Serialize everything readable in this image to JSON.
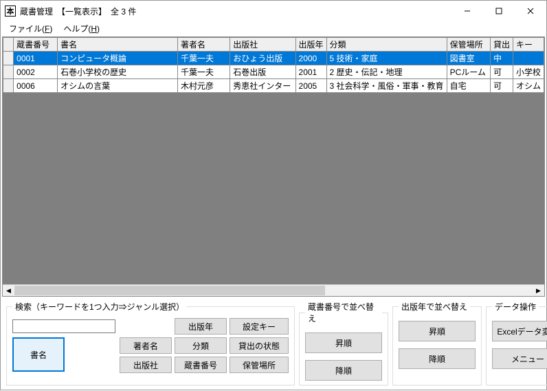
{
  "window": {
    "icon_glyph": "本",
    "title": "蔵書管理　【一覧表示】　全 3 件"
  },
  "menu": {
    "file": {
      "label": "ファイル",
      "hotkey": "F"
    },
    "help": {
      "label": "ヘルプ",
      "hotkey": "H"
    }
  },
  "table": {
    "headers": {
      "id": "蔵書番号",
      "name": "書名",
      "author": "著者名",
      "publisher": "出版社",
      "year": "出版年",
      "category": "分類",
      "location": "保管場所",
      "loan": "貸出",
      "key": "キー"
    },
    "rows": [
      {
        "id": "0001",
        "name": "コンピュータ概論",
        "author": "千葉一夫",
        "publisher": "おひょう出版",
        "year": "2000",
        "category": "5 技術・家庭",
        "location": "図書室",
        "loan": "中",
        "key": "",
        "selected": true
      },
      {
        "id": "0002",
        "name": "石巻小学校の歴史",
        "author": "千葉一夫",
        "publisher": "石巻出版",
        "year": "2001",
        "category": "2 歴史・伝記・地理",
        "location": "PCルーム",
        "loan": "可",
        "key": "小学校",
        "selected": false
      },
      {
        "id": "0006",
        "name": "オシムの言葉",
        "author": "木村元彦",
        "publisher": "秀恵社インター",
        "year": "2005",
        "category": "3 社会科学・風俗・軍事・教育",
        "location": "自宅",
        "loan": "可",
        "key": "オシム",
        "selected": false
      }
    ]
  },
  "search": {
    "legend": "検索（キーワードを1つ入力⇒ジャンル選択）",
    "value": "",
    "buttons": {
      "name": "書名",
      "author": "著者名",
      "publisher": "出版社",
      "year": "出版年",
      "category": "分類",
      "id": "蔵書番号",
      "setkey": "設定キー",
      "loanstate": "貸出の状態",
      "location": "保管場所"
    }
  },
  "sort_id": {
    "legend": "蔵書番号で並べ替え",
    "asc": "昇順",
    "desc": "降順"
  },
  "sort_year": {
    "legend": "出版年で並べ替え",
    "asc": "昇順",
    "desc": "降順"
  },
  "data_ops": {
    "legend": "データ操作",
    "excel": "Excelデータ変換",
    "menu": "メニュー"
  }
}
